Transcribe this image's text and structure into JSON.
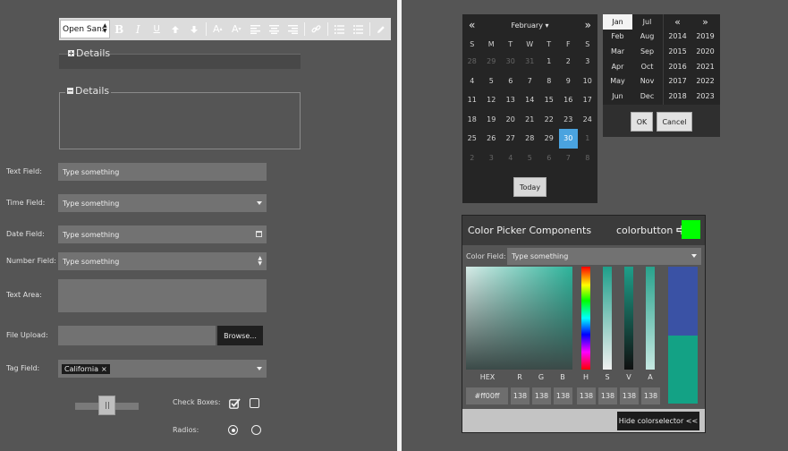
{
  "toolbar": {
    "font": "Open Sans",
    "bold": "B",
    "italic": "I",
    "underline": "U",
    "grow_font": "A",
    "shrink_font": "A"
  },
  "fieldsets": {
    "collapsed_legend": "Details",
    "open_legend": "Details"
  },
  "form": {
    "text_field": {
      "label": "Text Field:",
      "placeholder": "Type something"
    },
    "time_field": {
      "label": "Time Field:",
      "placeholder": "Type something"
    },
    "date_field": {
      "label": "Date Field:",
      "placeholder": "Type something"
    },
    "number_field": {
      "label": "Number Field:",
      "placeholder": "Type something"
    },
    "text_area": {
      "label": "Text Area:"
    },
    "file_upload": {
      "label": "File Upload:",
      "button": "Browse..."
    },
    "tag_field": {
      "label": "Tag Field:",
      "tags": [
        "California"
      ]
    },
    "check_boxes": {
      "label": "Check Boxes:",
      "states": [
        true,
        false
      ]
    },
    "radios": {
      "label": "Radios:",
      "states": [
        true,
        false
      ]
    }
  },
  "datepicker": {
    "prev": "«",
    "next": "»",
    "month": "February",
    "dow": [
      "S",
      "M",
      "T",
      "W",
      "T",
      "F",
      "S"
    ],
    "weeks": [
      [
        "28",
        "29",
        "30",
        "31",
        "1",
        "2",
        "3"
      ],
      [
        "4",
        "5",
        "6",
        "7",
        "8",
        "9",
        "10"
      ],
      [
        "11",
        "12",
        "13",
        "14",
        "15",
        "16",
        "17"
      ],
      [
        "18",
        "19",
        "20",
        "21",
        "22",
        "23",
        "24"
      ],
      [
        "25",
        "26",
        "27",
        "28",
        "29",
        "30",
        "1"
      ],
      [
        "2",
        "3",
        "4",
        "5",
        "6",
        "7",
        "8"
      ]
    ],
    "today_button": "Today"
  },
  "monthyear": {
    "months": [
      "Jan",
      "Jul",
      "Feb",
      "Aug",
      "Mar",
      "Sep",
      "Apr",
      "Oct",
      "May",
      "Nov",
      "Jun",
      "Dec"
    ],
    "prev": "«",
    "next": "»",
    "years": [
      "2014",
      "2019",
      "2015",
      "2020",
      "2016",
      "2021",
      "2017",
      "2022",
      "2018",
      "2023"
    ],
    "selected_month": "Jan",
    "ok": "OK",
    "cancel": "Cancel"
  },
  "colorpicker": {
    "title": "Color Picker Components",
    "button_label": "colorbutton",
    "button_color": "#00ff00",
    "color_field": {
      "label": "Color Field:",
      "placeholder": "Type something"
    },
    "labels": [
      "HEX",
      "R",
      "G",
      "B",
      "H",
      "S",
      "V",
      "A"
    ],
    "values": [
      "#ff00ff",
      "138",
      "138",
      "138",
      "138",
      "138",
      "138",
      "138"
    ],
    "hide_button": "Hide colorselector <<",
    "preview_old": "#3a52a5",
    "preview_new": "#13a285"
  }
}
